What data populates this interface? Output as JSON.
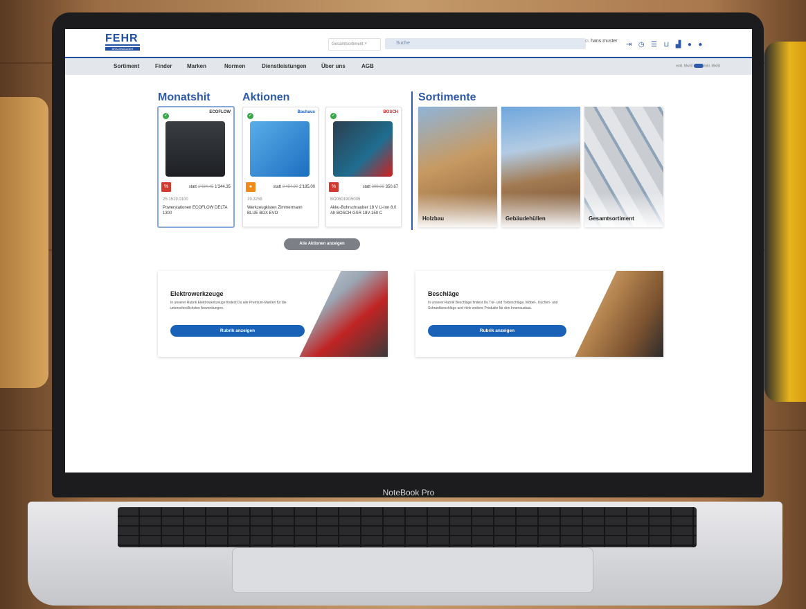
{
  "header": {
    "logo_main": "FEHR",
    "logo_sub": "BRAUNWALDER",
    "scope_select": "Gesamtsortiment",
    "search_placeholder": "Suche",
    "user": "hans.muster"
  },
  "nav": [
    "Sortiment",
    "Finder",
    "Marken",
    "Normen",
    "Dienstleistungen",
    "Über uns",
    "AGB"
  ],
  "toggle": {
    "left": "exkl. MwSt",
    "right": "inkl. MwSt"
  },
  "sections": {
    "monatshit": "Monatshit",
    "aktionen": "Aktionen",
    "sortimente": "Sortimente"
  },
  "products": [
    {
      "brand": "ECOFLOW",
      "badge": "%",
      "old_price": "1'484.45",
      "price_prefix": "statt",
      "price": "1'344.35",
      "sku": "25.1519.0100",
      "title": "Powerstationen ECOFLOW DELTA 1300"
    },
    {
      "brand": "Bauhaus",
      "badge": "●",
      "old_price": "2'494.90",
      "price_prefix": "statt",
      "price": "2'185.00",
      "sku": "19.3258",
      "title": "Werkzeugkisten Zimmermann BLUE BOX EVO"
    },
    {
      "brand": "BOSCH",
      "badge": "%",
      "old_price": "399.00",
      "price_prefix": "statt",
      "price": "350.67",
      "sku": "BO06019G5005",
      "title": "Akku-Bohrschrauber 18 V Li-Ion 8.0 Ah BOSCH GSR 18V-150 C"
    }
  ],
  "tiles": [
    "Holzbau",
    "Gebäudehüllen",
    "Gesamtsortiment"
  ],
  "all_actions": "Alle Aktionen anzeigen",
  "banners": [
    {
      "title": "Elektrowerkzeuge",
      "text": "In unserer Rubrik Elektrowerkzeuge findest Du alle Premium-Marken für die unterschiedlichsten Anwendungen.",
      "button": "Rubrik anzeigen"
    },
    {
      "title": "Beschläge",
      "text": "In unserer Rubrik Beschläge findest Du Tür- und Torbeschläge, Möbel-, Küchen- und Schrankbeschläge und viele weitere Produkte für den Innenausbau.",
      "button": "Rubrik anzeigen"
    }
  ],
  "device_label": "NoteBook Pro"
}
